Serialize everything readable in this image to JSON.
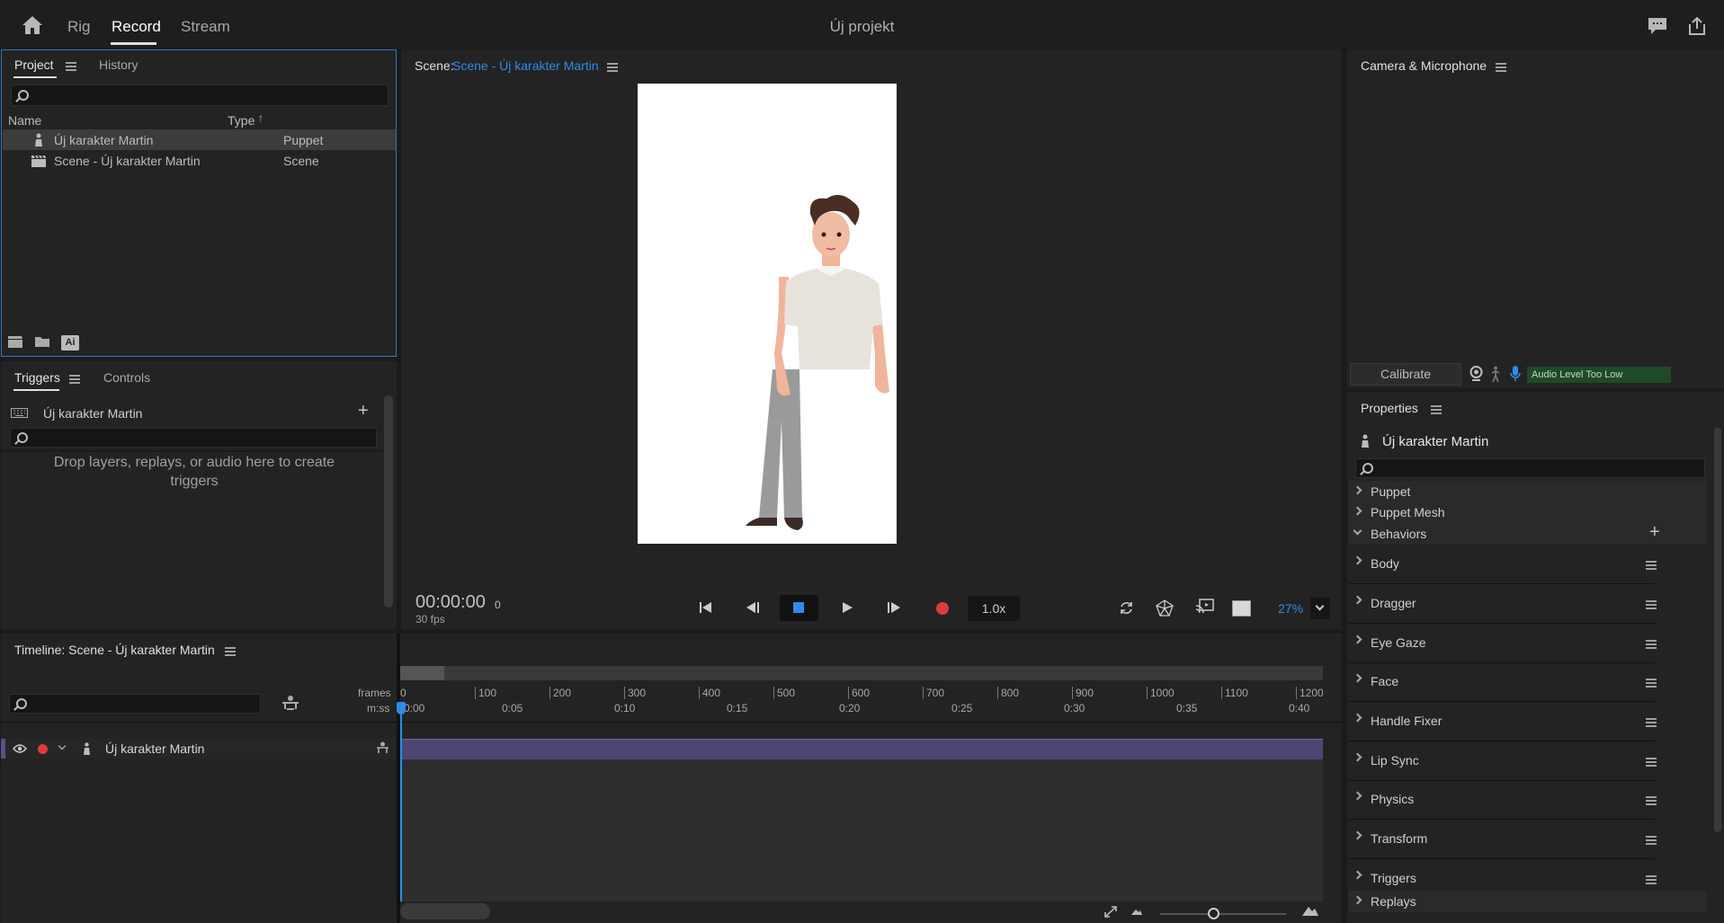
{
  "topbar": {
    "tabs": [
      "Rig",
      "Record",
      "Stream"
    ],
    "project_title": "Új projekt"
  },
  "project_panel": {
    "tabs": [
      "Project",
      "History"
    ],
    "columns": {
      "name": "Name",
      "type": "Type"
    },
    "items": [
      {
        "name": "Új karakter Martin",
        "type": "Puppet",
        "icon": "puppet-icon"
      },
      {
        "name": "Scene - Új karakter Martin",
        "type": "Scene",
        "icon": "scene-clapper-icon"
      }
    ],
    "footer_ai_label": "Ai"
  },
  "triggers_panel": {
    "tabs": [
      "Triggers",
      "Controls"
    ],
    "puppet_name": "Új karakter Martin",
    "drop_hint": "Drop layers, replays, or audio here to create triggers"
  },
  "scene_panel": {
    "label": "Scene:",
    "scene_name": "Scene - Új karakter Martin",
    "timecode": "00:00:00",
    "frame": "0",
    "fps": "30 fps",
    "speed": "1.0x",
    "zoom": "27%"
  },
  "camera_panel": {
    "title": "Camera & Microphone",
    "calibrate": "Calibrate",
    "audio_status": "Audio Level Too Low"
  },
  "properties_panel": {
    "title": "Properties",
    "puppet_name": "Új karakter Martin",
    "groups": [
      "Puppet",
      "Puppet Mesh",
      "Behaviors"
    ],
    "behaviors": [
      "Body",
      "Dragger",
      "Eye Gaze",
      "Face",
      "Handle Fixer",
      "Lip Sync",
      "Physics",
      "Transform",
      "Triggers"
    ],
    "last_group": "Replays"
  },
  "timeline_panel": {
    "title": "Timeline: Scene - Új karakter Martin",
    "frames_label": "frames",
    "mss_label": "m:ss",
    "frame_ticks": [
      "0",
      "100",
      "200",
      "300",
      "400",
      "500",
      "600",
      "700",
      "800",
      "900",
      "1000",
      "1100",
      "1200"
    ],
    "time_ticks": [
      "0:00",
      "0:05",
      "0:10",
      "0:15",
      "0:20",
      "0:25",
      "0:30",
      "0:35",
      "0:40"
    ],
    "track_name": "Új karakter Martin"
  },
  "colors": {
    "accent_blue": "#2d8ceb",
    "record_red": "#e03a3a",
    "track_purple": "#4e4672",
    "audio_green": "#1f4a2a"
  }
}
